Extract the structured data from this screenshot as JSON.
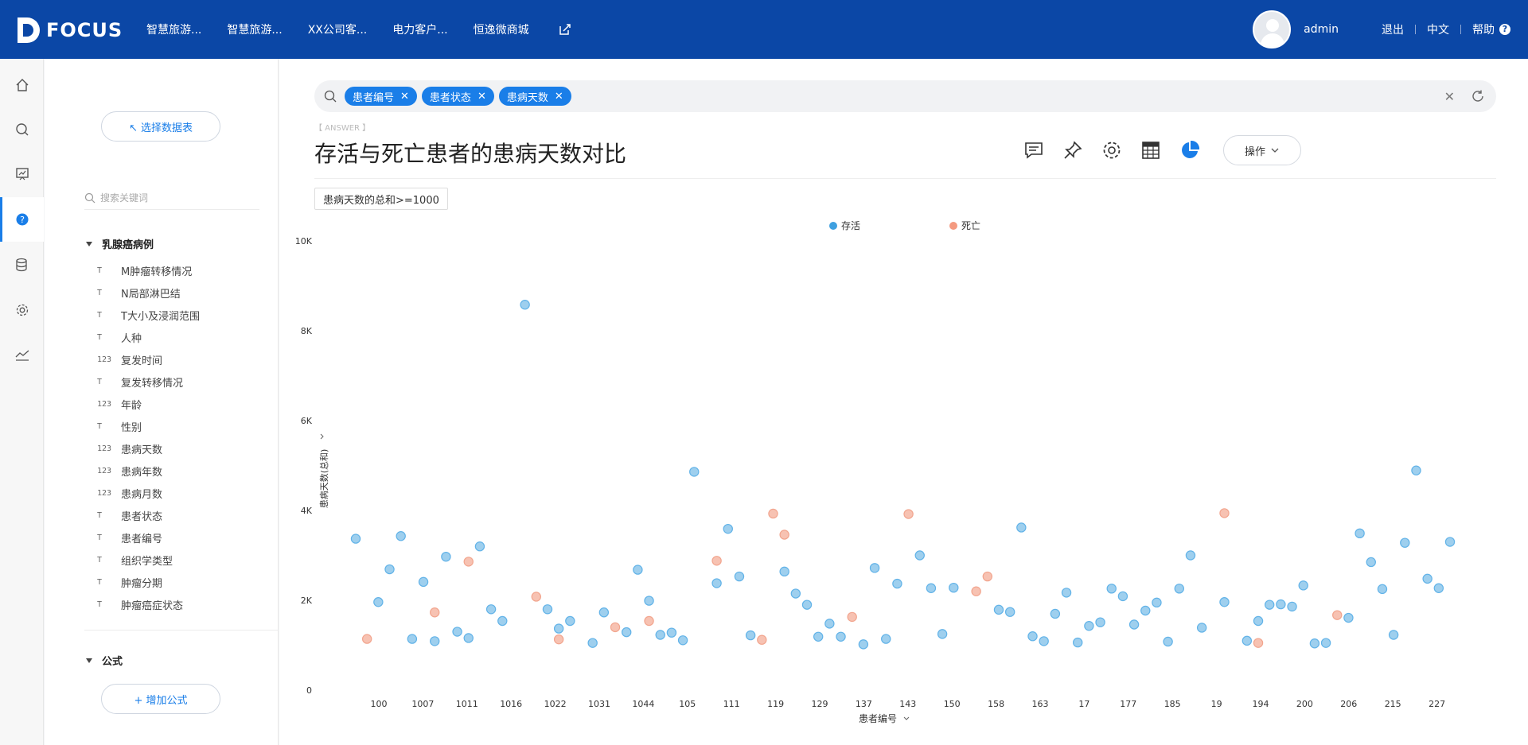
{
  "app": {
    "brand": "FOCUS"
  },
  "nav": {
    "items": [
      "智慧旅游...",
      "智慧旅游...",
      "XX公司客...",
      "电力客户...",
      "恒逸微商城"
    ]
  },
  "user": {
    "name": "admin",
    "logout": "退出",
    "language": "中文",
    "help": "帮助",
    "help_icon": "?"
  },
  "rail": {
    "items": [
      "home-icon",
      "search-icon",
      "dashboard-icon",
      "question-icon",
      "database-icon",
      "settings-icon",
      "trend-icon"
    ],
    "active": "question-icon"
  },
  "panel": {
    "select_table": "↖ 选择数据表",
    "search_placeholder": "搜索关键词",
    "table_name": "乳腺癌病例",
    "fields": [
      {
        "type": "text",
        "icon": "T",
        "name": "M肿瘤转移情况"
      },
      {
        "type": "text",
        "icon": "T",
        "name": "N局部淋巴结"
      },
      {
        "type": "text",
        "icon": "T",
        "name": "T大小及浸润范围"
      },
      {
        "type": "text",
        "icon": "T",
        "name": "人种"
      },
      {
        "type": "number",
        "icon": "123",
        "name": "复发时间"
      },
      {
        "type": "text",
        "icon": "T",
        "name": "复发转移情况"
      },
      {
        "type": "number",
        "icon": "123",
        "name": "年龄"
      },
      {
        "type": "text",
        "icon": "T",
        "name": "性别"
      },
      {
        "type": "number",
        "icon": "123",
        "name": "患病天数"
      },
      {
        "type": "number",
        "icon": "123",
        "name": "患病年数"
      },
      {
        "type": "number",
        "icon": "123",
        "name": "患病月数"
      },
      {
        "type": "text",
        "icon": "T",
        "name": "患者状态"
      },
      {
        "type": "text",
        "icon": "T",
        "name": "患者编号"
      },
      {
        "type": "text",
        "icon": "T",
        "name": "组织学类型"
      },
      {
        "type": "text",
        "icon": "T",
        "name": "肿瘤分期"
      },
      {
        "type": "text",
        "icon": "T",
        "name": "肿瘤癌症状态"
      }
    ],
    "formula_title": "公式",
    "add_formula": "+ 增加公式"
  },
  "search": {
    "chips": [
      "患者编号",
      "患者状态",
      "患病天数"
    ]
  },
  "answer": {
    "tag": "【 ANSWER 】",
    "title": "存活与死亡患者的患病天数对比",
    "operations": "操作",
    "filter": "患病天数的总和>=1000"
  },
  "colors": {
    "accent": "#1a7ee8",
    "topbar": "#0b47a6",
    "alive": "#9ecfee",
    "dead": "#f7c2b2"
  },
  "chart_data": {
    "type": "scatter",
    "xlabel": "患者编号",
    "ylabel": "患病天数(总和)",
    "ylim": [
      0,
      10000
    ],
    "yticks": [
      "0",
      "2K",
      "4K",
      "6K",
      "8K",
      "10K"
    ],
    "xticks": [
      "100",
      "1007",
      "1011",
      "1016",
      "1022",
      "1031",
      "1044",
      "105",
      "111",
      "119",
      "129",
      "137",
      "143",
      "150",
      "158",
      "163",
      "17",
      "177",
      "185",
      "19",
      "194",
      "200",
      "206",
      "215",
      "227"
    ],
    "legend": [
      "存活",
      "死亡"
    ],
    "legend_position": "top-center",
    "series": [
      {
        "name": "存活",
        "color": "#9ecfee",
        "points": [
          [
            0,
            3370
          ],
          [
            2,
            1960
          ],
          [
            3,
            2690
          ],
          [
            4,
            3430
          ],
          [
            5,
            1140
          ],
          [
            6,
            2410
          ],
          [
            7,
            1090
          ],
          [
            8,
            2970
          ],
          [
            9,
            1300
          ],
          [
            10,
            1160
          ],
          [
            11,
            3200
          ],
          [
            12,
            1800
          ],
          [
            13,
            1540
          ],
          [
            15,
            8580
          ],
          [
            17,
            1800
          ],
          [
            18,
            1370
          ],
          [
            19,
            1540
          ],
          [
            21,
            1050
          ],
          [
            22,
            1730
          ],
          [
            24,
            1290
          ],
          [
            25,
            2680
          ],
          [
            26,
            1990
          ],
          [
            27,
            1230
          ],
          [
            28,
            1280
          ],
          [
            29,
            1110
          ],
          [
            30,
            4860
          ],
          [
            32,
            2380
          ],
          [
            33,
            3590
          ],
          [
            34,
            2530
          ],
          [
            35,
            1220
          ],
          [
            38,
            2640
          ],
          [
            39,
            2150
          ],
          [
            40,
            1900
          ],
          [
            41,
            1190
          ],
          [
            42,
            1480
          ],
          [
            43,
            1190
          ],
          [
            45,
            1020
          ],
          [
            46,
            2720
          ],
          [
            47,
            1140
          ],
          [
            48,
            2370
          ],
          [
            50,
            3000
          ],
          [
            51,
            2270
          ],
          [
            52,
            1250
          ],
          [
            53,
            2280
          ],
          [
            57,
            1790
          ],
          [
            58,
            1740
          ],
          [
            59,
            3620
          ],
          [
            60,
            1200
          ],
          [
            61,
            1090
          ],
          [
            62,
            1700
          ],
          [
            63,
            2170
          ],
          [
            64,
            1060
          ],
          [
            65,
            1430
          ],
          [
            66,
            1510
          ],
          [
            67,
            2260
          ],
          [
            68,
            2090
          ],
          [
            69,
            1460
          ],
          [
            70,
            1770
          ],
          [
            71,
            1950
          ],
          [
            72,
            1080
          ],
          [
            73,
            2260
          ],
          [
            74,
            3000
          ],
          [
            75,
            1390
          ],
          [
            77,
            1960
          ],
          [
            79,
            1100
          ],
          [
            80,
            1540
          ],
          [
            81,
            1900
          ],
          [
            82,
            1910
          ],
          [
            83,
            1860
          ],
          [
            84,
            2330
          ],
          [
            85,
            1040
          ],
          [
            86,
            1050
          ],
          [
            88,
            1610
          ],
          [
            89,
            3490
          ],
          [
            90,
            2850
          ],
          [
            91,
            2250
          ],
          [
            92,
            1230
          ],
          [
            93,
            3280
          ],
          [
            94,
            4890
          ],
          [
            95,
            2480
          ],
          [
            96,
            2270
          ],
          [
            97,
            3300
          ]
        ]
      },
      {
        "name": "死亡",
        "color": "#f7c2b2",
        "points": [
          [
            1,
            1140
          ],
          [
            7,
            1730
          ],
          [
            10,
            2860
          ],
          [
            16,
            2080
          ],
          [
            18,
            1130
          ],
          [
            23,
            1400
          ],
          [
            26,
            1540
          ],
          [
            32,
            2880
          ],
          [
            36,
            1120
          ],
          [
            37,
            3930
          ],
          [
            38,
            3460
          ],
          [
            44,
            1630
          ],
          [
            49,
            3920
          ],
          [
            55,
            2200
          ],
          [
            56,
            2530
          ],
          [
            77,
            3940
          ],
          [
            80,
            1050
          ],
          [
            87,
            1670
          ]
        ]
      }
    ]
  }
}
